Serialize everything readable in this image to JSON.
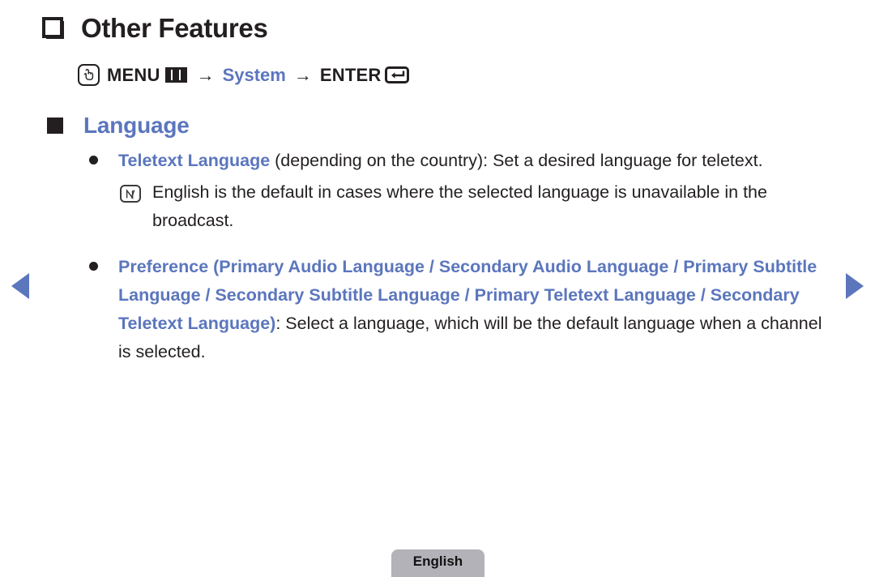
{
  "colors": {
    "accent_blue": "#5b76bd",
    "text_dark": "#231f20",
    "tab_gray": "#b2b2b8"
  },
  "nav": {
    "prev_label": "Previous page",
    "next_label": "Next page"
  },
  "header": {
    "bullet_icon": "cube-icon",
    "title": "Other Features"
  },
  "menu_path": {
    "press_icon": "hand-press-icon",
    "menu_label": "MENU",
    "menu_icon": "menu-grid-icon",
    "arrow": "→",
    "target": "System",
    "enter_label": "ENTER",
    "enter_icon": "enter-key-icon"
  },
  "section": {
    "bullet_icon": "filled-square-icon",
    "title": "Language"
  },
  "content": {
    "items": [
      {
        "type": "bullet",
        "highlight": "Teletext Language",
        "rest": " (depending on the country): Set a desired language for teletext."
      },
      {
        "type": "note",
        "icon": "note-icon",
        "text": "English is the default in cases where the selected language is unavailable in the broadcast."
      },
      {
        "type": "bullet",
        "highlight": "Preference (Primary Audio Language / Secondary Audio Language / Primary Subtitle Language / Secondary Subtitle Language / Primary Teletext Language / Secondary Teletext Language)",
        "rest": ": Select a language, which will be the default language when a channel is selected."
      }
    ]
  },
  "footer": {
    "language_tab": "English"
  }
}
